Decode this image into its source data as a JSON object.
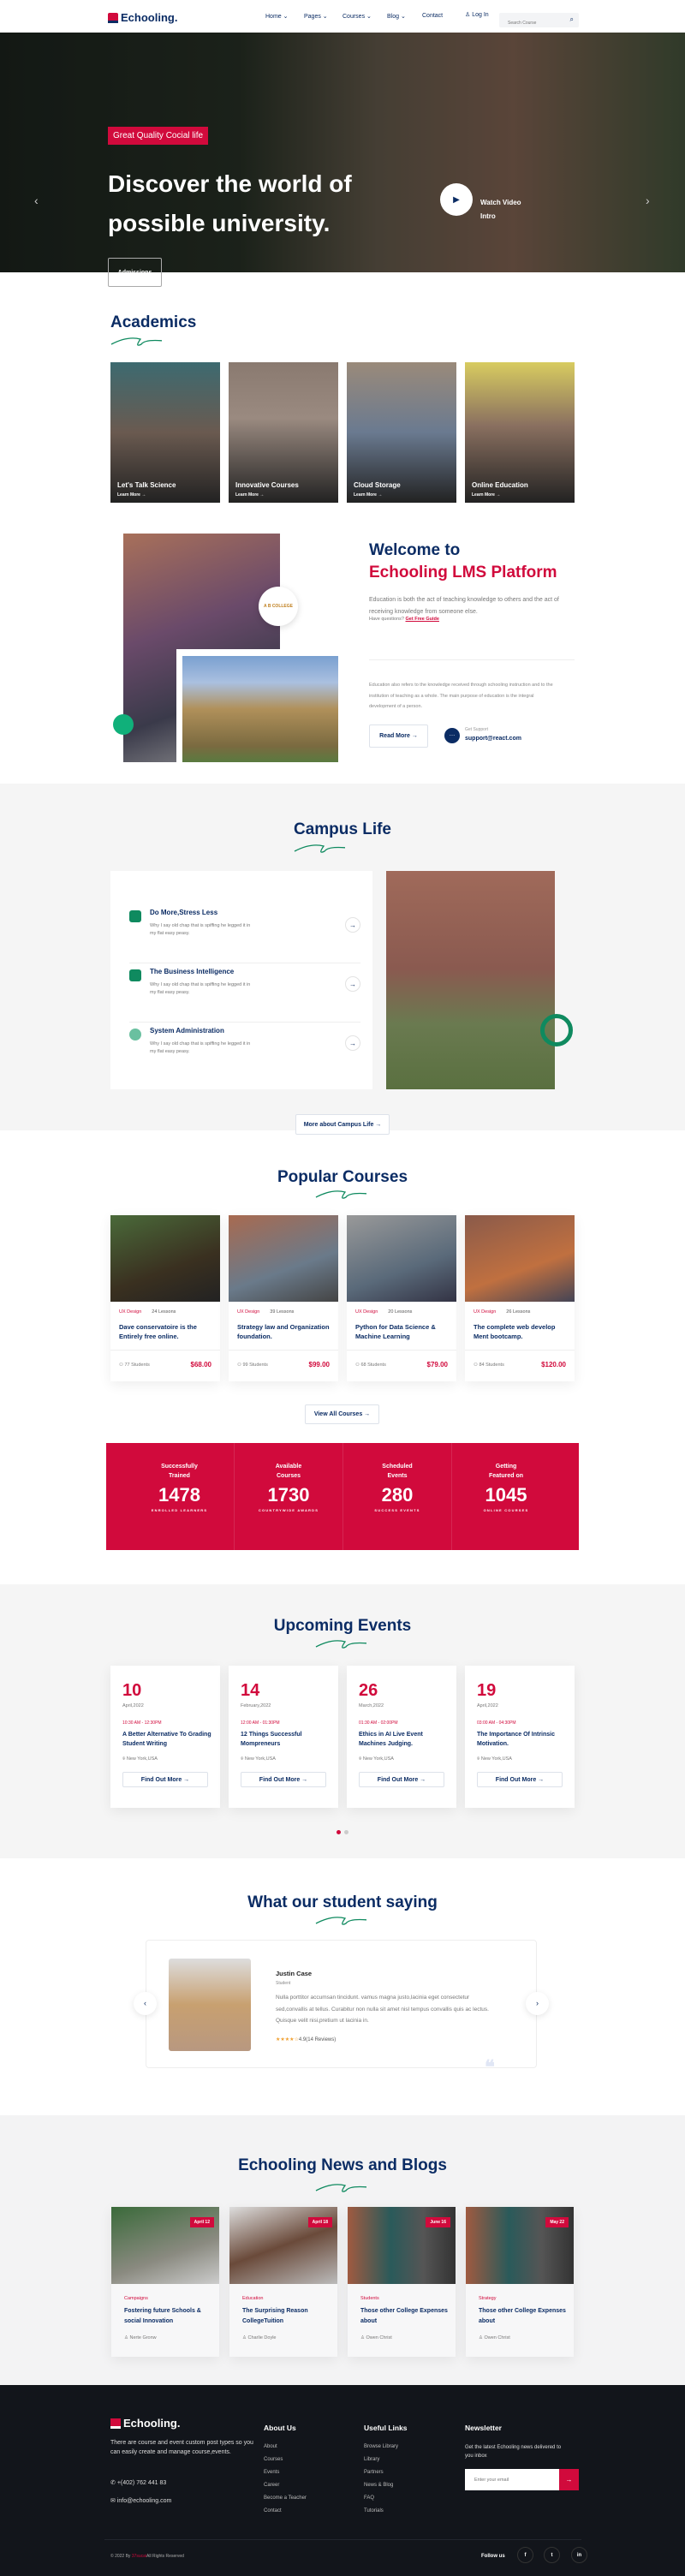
{
  "header": {
    "logo": "Echooling.",
    "nav": [
      "Home",
      "Pages",
      "Courses",
      "Blog",
      "Contact"
    ],
    "login": "Log In",
    "search_placeholder": "Search Course"
  },
  "hero": {
    "tag": "Great Quality Cocial life",
    "title_line1": "Discover the world of",
    "title_line2": "possible university.",
    "button": "Admissions",
    "video_label": "Watch Video Intro"
  },
  "academics": {
    "title": "Academics",
    "cards": [
      {
        "title": "Let's Talk Science",
        "link": "Learn More →"
      },
      {
        "title": "Innovative Courses",
        "link": "Learn More →"
      },
      {
        "title": "Cloud Storage",
        "link": "Learn More →"
      },
      {
        "title": "Online Education",
        "link": "Learn More →"
      }
    ]
  },
  "welcome": {
    "title1": "Welcome to",
    "title2": "Echooling LMS Platform",
    "text1": "Education is both the act of teaching knowledge to others and the act of receiving knowledge from someone else.",
    "question": "Have questions?",
    "guide_link": "Get Free Guide",
    "text2": "Education also refers to the knowledge received through schooling instruction and to the institution of teaching as a whole. The main purpose of education is the integral development of a person.",
    "read_more": "Read More →",
    "support_label": "Get Support",
    "support_email": "support@react.com",
    "badge": "A B COLLEGE"
  },
  "campus": {
    "title": "Campus Life",
    "items": [
      {
        "title": "Do More,Stress Less",
        "desc": "Why I say old chap that is spiffing he legged it in my flat easy peasy."
      },
      {
        "title": "The Business Intelligence",
        "desc": "Why I say old chap that is spiffing he legged it in my flat easy peasy."
      },
      {
        "title": "System Administration",
        "desc": "Why I say old chap that is spiffing he legged it in my flat easy peasy."
      }
    ],
    "button": "More about Campus Life →"
  },
  "courses": {
    "title": "Popular Courses",
    "items": [
      {
        "category": "UX Design",
        "lessons": "24 Lessons",
        "title": "Dave conservatoire is the Entirely free online.",
        "students": "77 Students",
        "price": "$68.00"
      },
      {
        "category": "UX Design",
        "lessons": "39 Lessons",
        "title": "Strategy law and Organization foundation.",
        "students": "99 Students",
        "price": "$99.00"
      },
      {
        "category": "UX Design",
        "lessons": "20 Lessons",
        "title": "Python for Data Science & Machine Learning",
        "students": "68 Students",
        "price": "$79.00"
      },
      {
        "category": "UX Design",
        "lessons": "26 Lessons",
        "title": "The complete web develop Ment bootcamp.",
        "students": "84 Students",
        "price": "$120.00"
      }
    ],
    "button": "View All Courses →"
  },
  "stats": [
    {
      "label1": "Successfully",
      "label2": "Trained",
      "number": "1478",
      "sub": "ENROLLED LEARNERS"
    },
    {
      "label1": "Available",
      "label2": "Courses",
      "number": "1730",
      "sub": "COUNTRYWIDE AWARDS"
    },
    {
      "label1": "Scheduled",
      "label2": "Events",
      "number": "280",
      "sub": "SUCCESS EVENTS"
    },
    {
      "label1": "Getting",
      "label2": "Featured on",
      "number": "1045",
      "sub": "ONLINE COURSES"
    }
  ],
  "events": {
    "title": "Upcoming Events",
    "items": [
      {
        "day": "10",
        "month": "April,2022",
        "time": "10:30 AM - 12:30PM",
        "title": "A Better Alternative To Grading Student Writing",
        "location": "New York,USA",
        "button": "Find Out More →"
      },
      {
        "day": "14",
        "month": "February,2022",
        "time": "12:00 AM - 01:30PM",
        "title": "12 Things Successful Mompreneurs",
        "location": "New York,USA",
        "button": "Find Out More →"
      },
      {
        "day": "26",
        "month": "March,2022",
        "time": "01:30 AM - 02:00PM",
        "title": "Ethics in AI Live Event Machines Judging.",
        "location": "New York,USA",
        "button": "Find Out More →"
      },
      {
        "day": "19",
        "month": "April,2022",
        "time": "03:00 AM - 04:30PM",
        "title": "The Importance Of Intrinsic Motivation.",
        "location": "New York,USA",
        "button": "Find Out More →"
      }
    ]
  },
  "testimonial": {
    "title": "What our student saying",
    "name": "Justin Case",
    "role": "Student",
    "text": "Nulla porttitor accumsan tincidunt. vamus magna justo,lacinia eget consectetur sed,convallis at tellus. Curabitur non nulla sit amet nisl tempus convallis quis ac lectus. Quisque velit nisi,pretium ut lacinia in.",
    "stars": "★★★★☆",
    "rating": "4.9(14 Reviews)",
    "rating_value": 4
  },
  "news": {
    "title": "Echooling News and Blogs",
    "items": [
      {
        "date": "April 12",
        "category": "Campaigns",
        "title": "Fostering future Schools & social Innovation",
        "author": "Nerte Gronw"
      },
      {
        "date": "April 18",
        "category": "Education",
        "title": "The Surprising Reason CollegeTuition",
        "author": "Charlie Doyle"
      },
      {
        "date": "June 16",
        "category": "Students",
        "title": "Those other College Expenses about",
        "author": "Owen Christ"
      },
      {
        "date": "May 22",
        "category": "Strategy",
        "title": "Those other College Expenses about",
        "author": "Owen Christ"
      }
    ]
  },
  "footer": {
    "logo": "Echooling.",
    "desc": "There are course and event custom post types so you can easily create and manage course,events.",
    "phone": "+(402) 762 441 83",
    "email": "info@echooling.com",
    "about_title": "About Us",
    "about_links": [
      "About",
      "Courses",
      "Events",
      "Career",
      "Become a Teacher",
      "Contact"
    ],
    "useful_title": "Useful Links",
    "useful_links": [
      "Browse Library",
      "Library",
      "Partners",
      "News & Blog",
      "FAQ",
      "Tutorials"
    ],
    "newsletter_title": "Newsletter",
    "newsletter_text": "Get the latest Echooling news delivered to you inbox",
    "email_placeholder": "Enter your email",
    "copyright_pre": "© 2022 By",
    "copyright_brand": "37sucai",
    "copyright_post": "All Rights Reserved",
    "follow": "Follow us",
    "social": [
      "f",
      "t",
      "in"
    ]
  },
  "colors": {
    "primary": "#0b2c64",
    "accent": "#d10a3c",
    "green": "#0f8a5f",
    "footer_bg": "#12151b"
  }
}
